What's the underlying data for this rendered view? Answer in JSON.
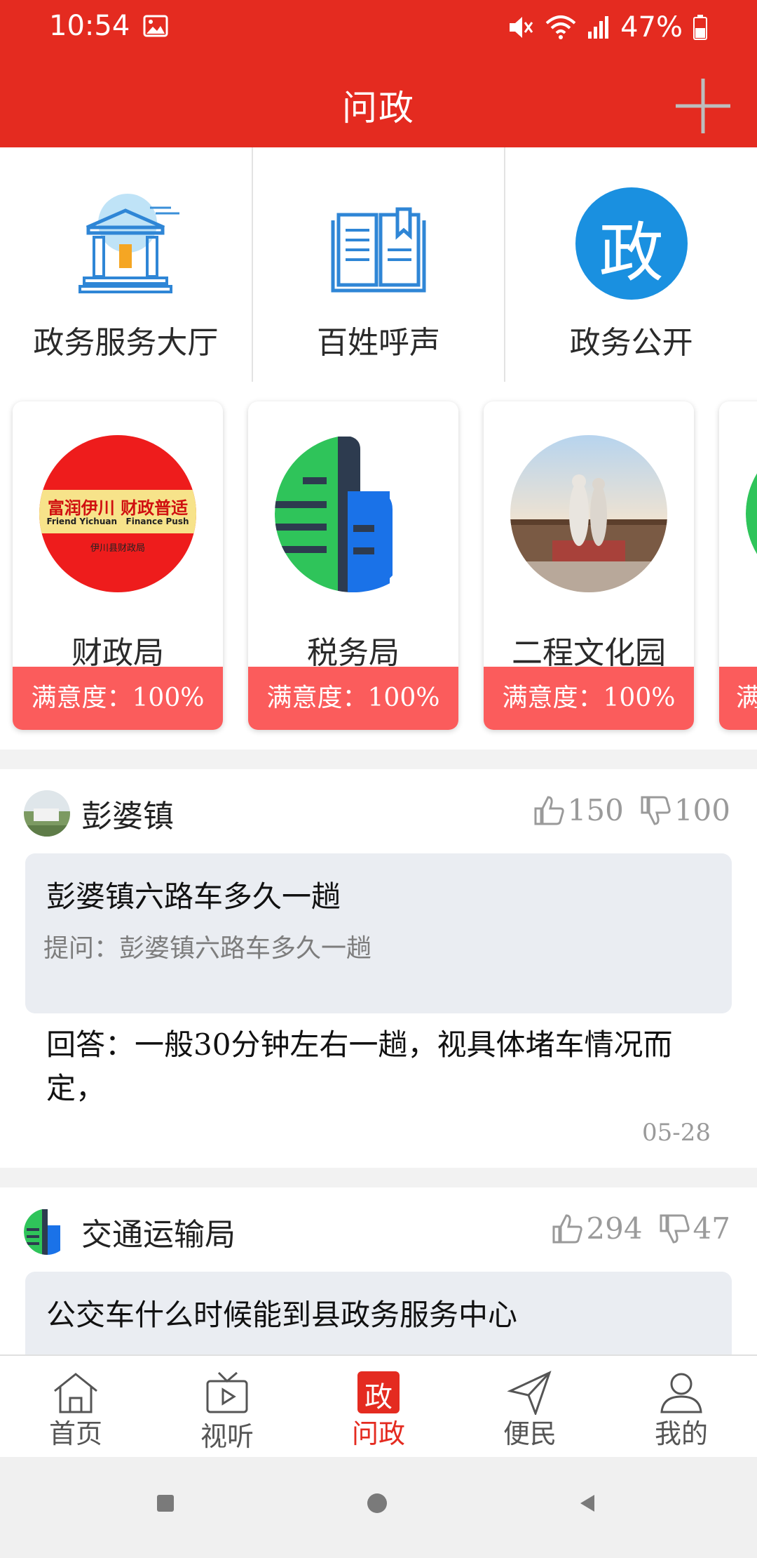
{
  "status_bar": {
    "time": "10:54",
    "battery": "47%"
  },
  "header": {
    "title": "问政"
  },
  "quick_links": [
    {
      "label": "政务服务大厅",
      "icon": "government-building-icon"
    },
    {
      "label": "百姓呼声",
      "icon": "open-book-icon"
    },
    {
      "label": "政务公开",
      "icon": "zheng-badge-icon",
      "badge_char": "政"
    }
  ],
  "departments": [
    {
      "name": "财政局",
      "satisfaction": "满意度：100%",
      "logo": {
        "line1": "富润伊川  财政普适",
        "line2": "Friend Yichuan   Finance Push",
        "line3": "伊川县财政局"
      }
    },
    {
      "name": "税务局",
      "satisfaction": "满意度：100%"
    },
    {
      "name": "二程文化园",
      "satisfaction": "满意度：100%"
    },
    {
      "name": "",
      "satisfaction": "满"
    }
  ],
  "feed": [
    {
      "org": "彭婆镇",
      "likes": "150",
      "dislikes": "100",
      "question_title": "彭婆镇六路车多久一趟",
      "question_detail": "提问：彭婆镇六路车多久一趟",
      "answer": "回答：一般30分钟左右一趟，视具体堵车情况而定，",
      "date": "05-28"
    },
    {
      "org": "交通运输局",
      "likes": "294",
      "dislikes": "47",
      "question_title": "公交车什么时候能到县政务服务中心"
    }
  ],
  "bottom_nav": [
    {
      "label": "首页",
      "icon": "home-icon"
    },
    {
      "label": "视听",
      "icon": "tv-icon"
    },
    {
      "label": "问政",
      "icon": "zheng-icon",
      "badge_char": "政",
      "active": true
    },
    {
      "label": "便民",
      "icon": "send-icon"
    },
    {
      "label": "我的",
      "icon": "profile-icon"
    }
  ],
  "colors": {
    "brand_red": "#e42b20",
    "satisfaction_red": "#fb5c5c",
    "zheng_blue": "#1a90e0"
  }
}
